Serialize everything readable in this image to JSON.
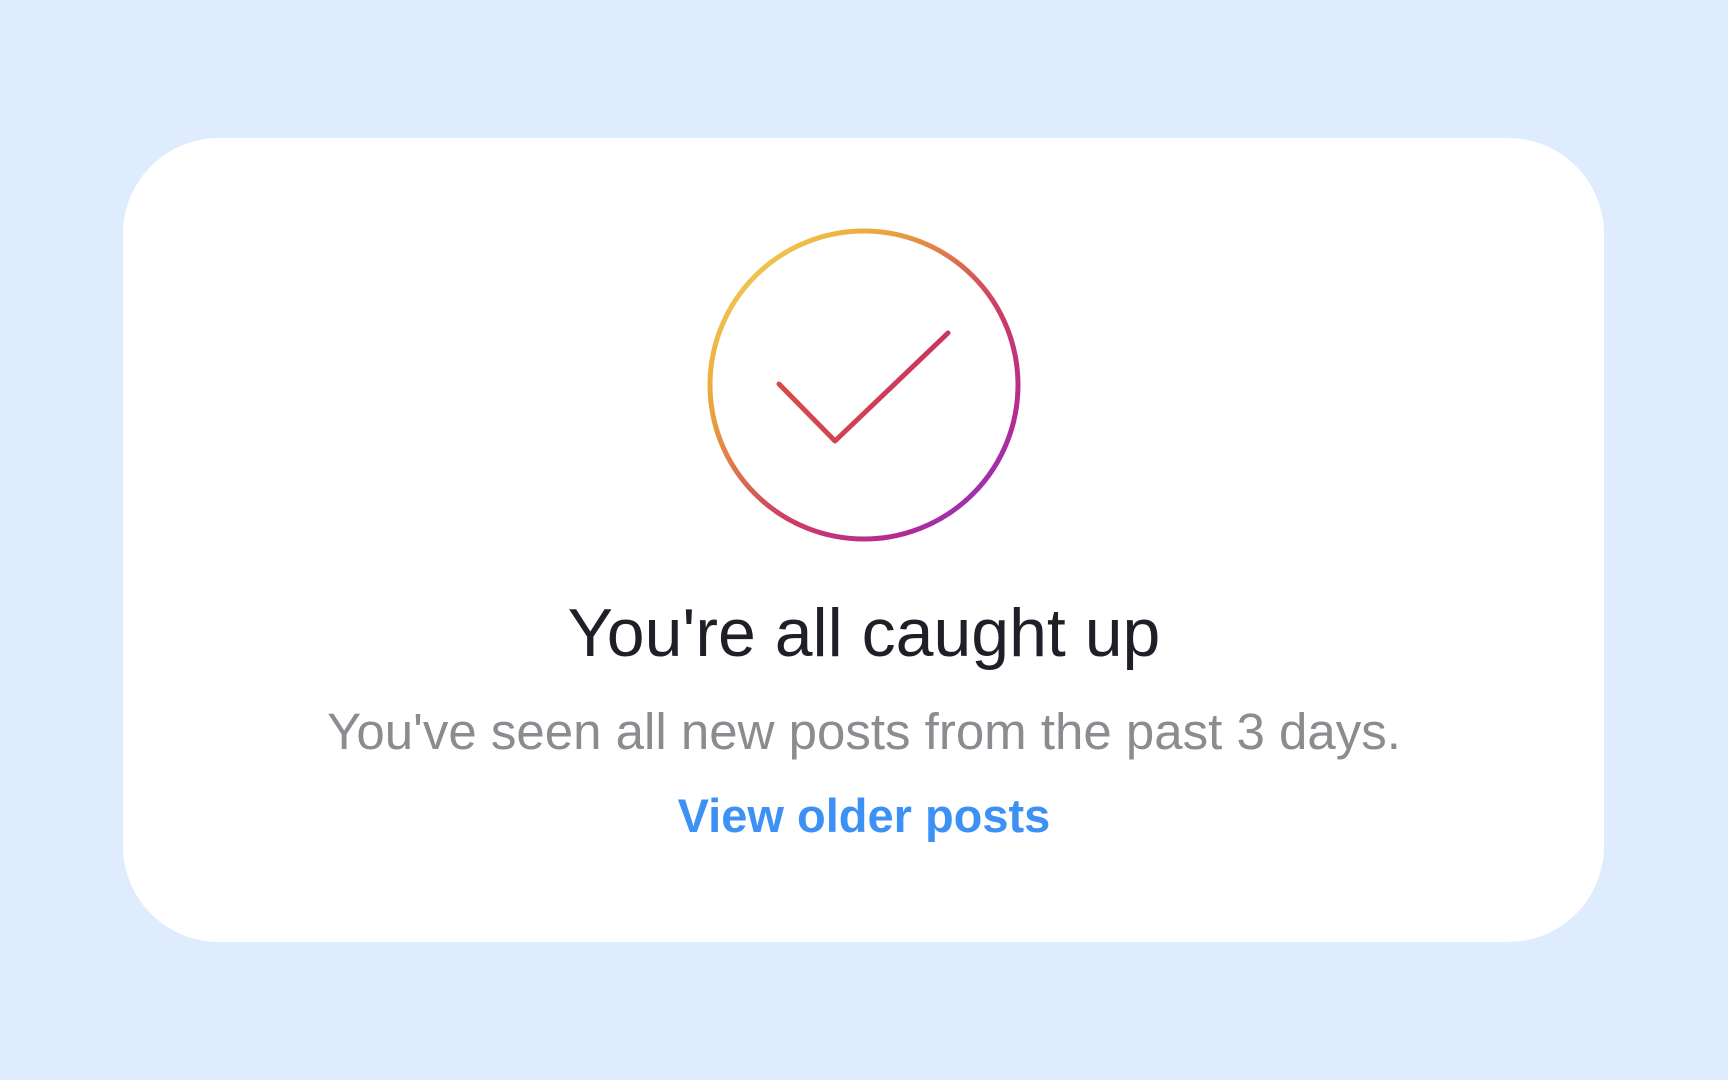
{
  "card": {
    "icon": "checkmark-circle-icon",
    "title": "You're all caught up",
    "subtitle": "You've seen all new posts from the past 3 days.",
    "link_label": "View older posts"
  },
  "colors": {
    "background": "#dfecfd",
    "card": "#ffffff",
    "title": "#1f2027",
    "subtitle": "#8b8b90",
    "link": "#3d91f4",
    "gradient": [
      "#f2c74e",
      "#e56a3a",
      "#c2307a",
      "#7a39d8"
    ]
  }
}
